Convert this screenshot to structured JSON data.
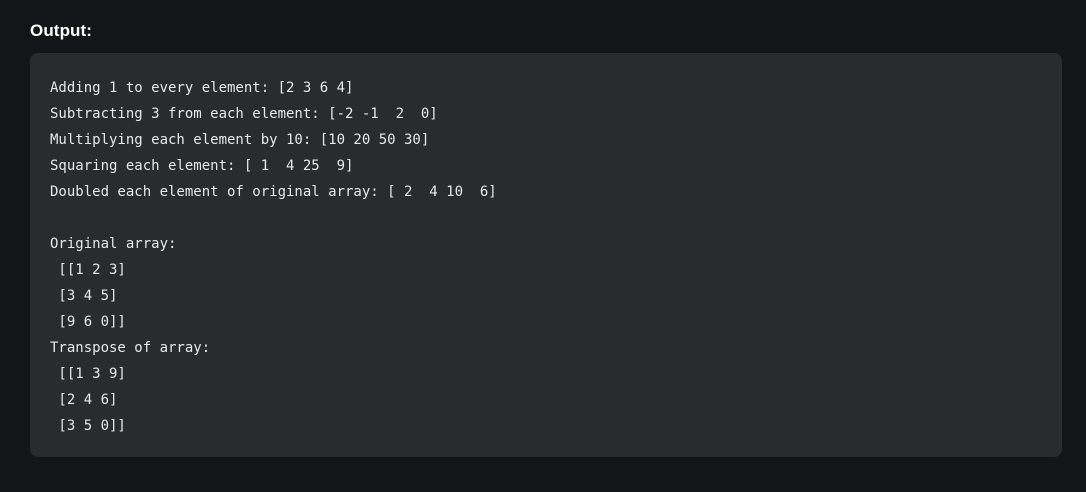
{
  "heading": "Output:",
  "output_lines": [
    "Adding 1 to every element: [2 3 6 4]",
    "Subtracting 3 from each element: [-2 -1  2  0]",
    "Multiplying each element by 10: [10 20 50 30]",
    "Squaring each element: [ 1  4 25  9]",
    "Doubled each element of original array: [ 2  4 10  6]",
    "",
    "Original array:",
    " [[1 2 3]",
    " [3 4 5]",
    " [9 6 0]]",
    "Transpose of array:",
    " [[1 3 9]",
    " [2 4 6]",
    " [3 5 0]]"
  ]
}
